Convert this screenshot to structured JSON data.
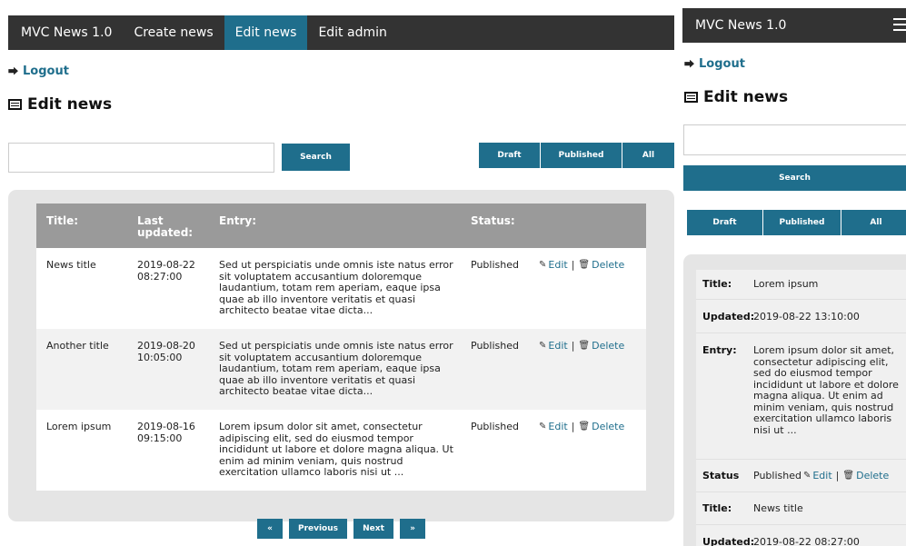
{
  "app": {
    "brand": "MVC News 1.0"
  },
  "nav": {
    "items": [
      "Create news",
      "Edit news",
      "Edit admin"
    ],
    "active": "Edit news"
  },
  "logout_label": "Logout",
  "page_title": "Edit news",
  "search": {
    "value": "",
    "placeholder": "",
    "button_label": "Search"
  },
  "filters": [
    "Draft",
    "Published",
    "All"
  ],
  "table": {
    "columns": [
      "Title:",
      "Last updated:",
      "Entry:",
      "Status:"
    ],
    "edit_label": "Edit",
    "delete_label": "Delete",
    "separator": "|",
    "rows": [
      {
        "title": "News title",
        "updated": "2019-08-22 08:27:00",
        "entry": "Sed ut perspiciatis unde omnis iste natus error sit voluptatem accusantium doloremque laudantium, totam rem aperiam, eaque ipsa quae ab illo inventore veritatis et quasi architecto beatae vitae dicta...",
        "status": "Published"
      },
      {
        "title": "Another title",
        "updated": "2019-08-20 10:05:00",
        "entry": "Sed ut perspiciatis unde omnis iste natus error sit voluptatem accusantium doloremque laudantium, totam rem aperiam, eaque ipsa quae ab illo inventore veritatis et quasi architecto beatae vitae dicta...",
        "status": "Published"
      },
      {
        "title": "Lorem ipsum",
        "updated": "2019-08-16 09:15:00",
        "entry": "Lorem ipsum dolor sit amet, consectetur adipiscing elit, sed do eiusmod tempor incididunt ut labore et dolore magna aliqua. Ut enim ad minim veniam, quis nostrud exercitation ullamco laboris nisi ut ...",
        "status": "Published"
      }
    ]
  },
  "pagination": {
    "first": "«",
    "previous": "Previous",
    "next": "Next",
    "last": "»"
  },
  "mobile": {
    "labels": {
      "title": "Title:",
      "updated": "Updated:",
      "entry": "Entry:",
      "status": "Status"
    },
    "cards": [
      {
        "title": "Lorem ipsum",
        "updated": "2019-08-22 13:10:00",
        "entry": "Lorem ipsum dolor sit amet, consectetur adipiscing elit, sed do eiusmod tempor incididunt ut labore et dolore magna aliqua. Ut enim ad minim veniam, quis nostrud exercitation ullamco laboris nisi ut ...",
        "status": "Published"
      },
      {
        "title": "News title",
        "updated": "2019-08-22 08:27:00"
      }
    ]
  },
  "colors": {
    "nav_bg": "#333333",
    "accent": "#1f6e8c",
    "header_gray": "#9a9a9a",
    "panel_bg": "#e5e5e5"
  }
}
